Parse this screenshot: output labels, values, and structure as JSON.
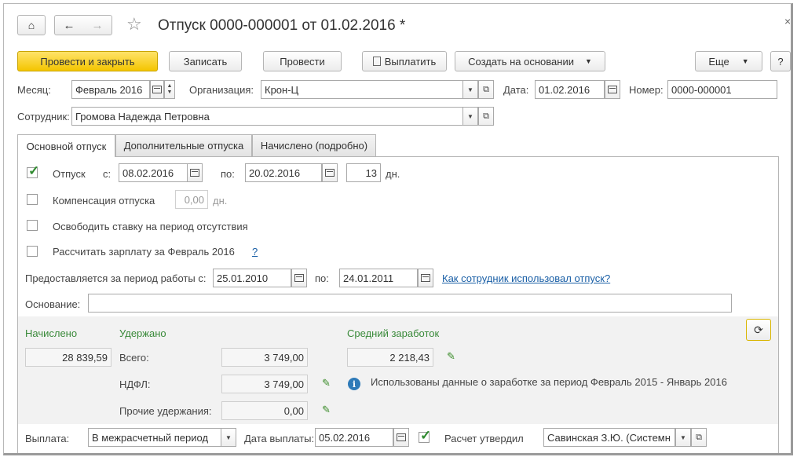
{
  "title": "Отпуск 0000-000001 от 01.02.2016 *",
  "toolbar": {
    "post_close": "Провести и закрыть",
    "save": "Записать",
    "post": "Провести",
    "pay": "Выплатить",
    "create_based": "Создать на основании",
    "more": "Еще",
    "help": "?"
  },
  "header": {
    "month_label": "Месяц:",
    "month_value": "Февраль 2016",
    "org_label": "Организация:",
    "org_value": "Крон-Ц",
    "date_label": "Дата:",
    "date_value": "01.02.2016",
    "number_label": "Номер:",
    "number_value": "0000-000001",
    "employee_label": "Сотрудник:",
    "employee_value": "Громова Надежда Петровна"
  },
  "tabs": [
    "Основной отпуск",
    "Дополнительные отпуска",
    "Начислено (подробно)"
  ],
  "main": {
    "vacation_label": "Отпуск",
    "from_label": "с:",
    "from_value": "08.02.2016",
    "to_label": "по:",
    "to_value": "20.02.2016",
    "days_value": "13",
    "days_unit": "дн.",
    "comp_label": "Компенсация отпуска",
    "comp_value": "0,00",
    "comp_unit": "дн.",
    "free_rate_label": "Освободить ставку на период отсутствия",
    "calc_salary_label": "Рассчитать зарплату за Февраль 2016",
    "calc_salary_help": "?",
    "period_label": "Предоставляется за период работы с:",
    "period_from": "25.01.2010",
    "period_to_label": "по:",
    "period_to": "24.01.2011",
    "usage_link": "Как сотрудник использовал отпуск?",
    "basis_label": "Основание:",
    "basis_value": ""
  },
  "totals": {
    "accrued_label": "Начислено",
    "accrued_value": "28 839,59",
    "withheld_label": "Удержано",
    "total_label": "Всего:",
    "total_value": "3 749,00",
    "ndfl_label": "НДФЛ:",
    "ndfl_value": "3 749,00",
    "other_label": "Прочие удержания:",
    "other_value": "0,00",
    "avg_label": "Средний заработок",
    "avg_value": "2 218,43",
    "info_text": "Использованы данные о заработке за период Февраль 2015 - Январь 2016"
  },
  "footer": {
    "payment_label": "Выплата:",
    "payment_value": "В межрасчетный период",
    "pay_date_label": "Дата выплаты:",
    "pay_date_value": "05.02.2016",
    "approved_label": "Расчет утвердил",
    "approved_value": "Савинская З.Ю. (Системн"
  },
  "colors": {
    "primary_button": "#f4c500",
    "section_green": "#3a8a3a",
    "link_blue": "#1a5fa6",
    "check_green": "#2f8a2f"
  }
}
